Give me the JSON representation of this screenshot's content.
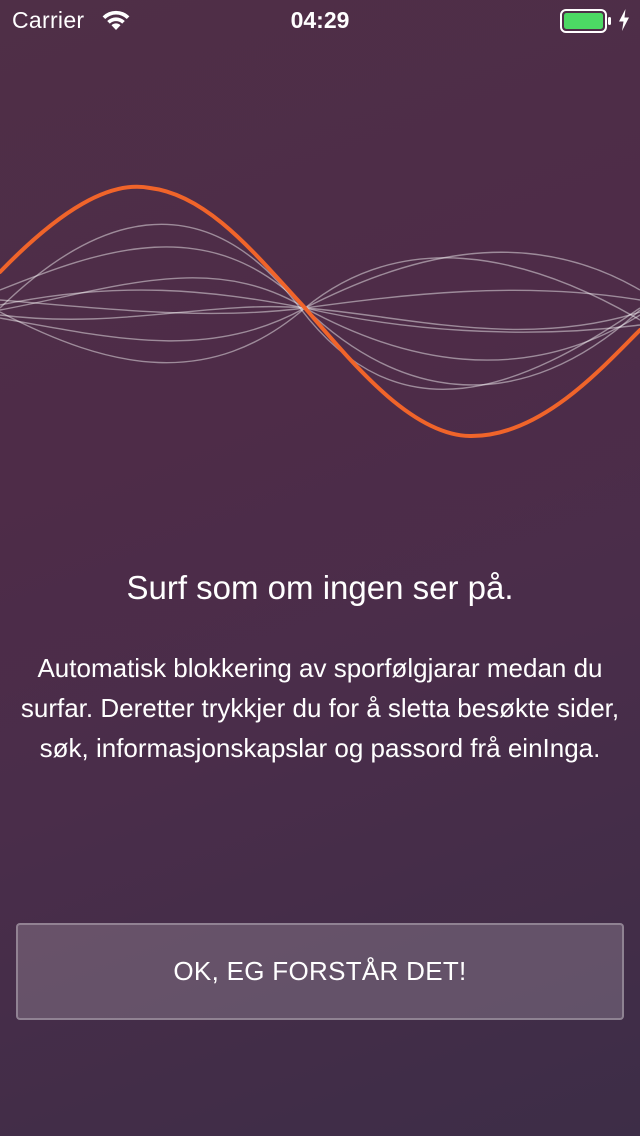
{
  "status_bar": {
    "carrier": "Carrier",
    "time": "04:29",
    "battery_color": "#4cd964"
  },
  "onboarding": {
    "headline": "Surf som om ingen ser på.",
    "description": "Automatisk blokkering av sporfølgjarar medan du surfar. Deretter trykkjer du for å sletta besøkte sider, søk, informasjonskapslar og passord frå einInga.",
    "cta_label": "OK, EG FORSTÅR DET!"
  },
  "colors": {
    "accent_wave": "#f0642a",
    "background_top": "#4f2f47",
    "background_bottom": "#3d2d47"
  }
}
